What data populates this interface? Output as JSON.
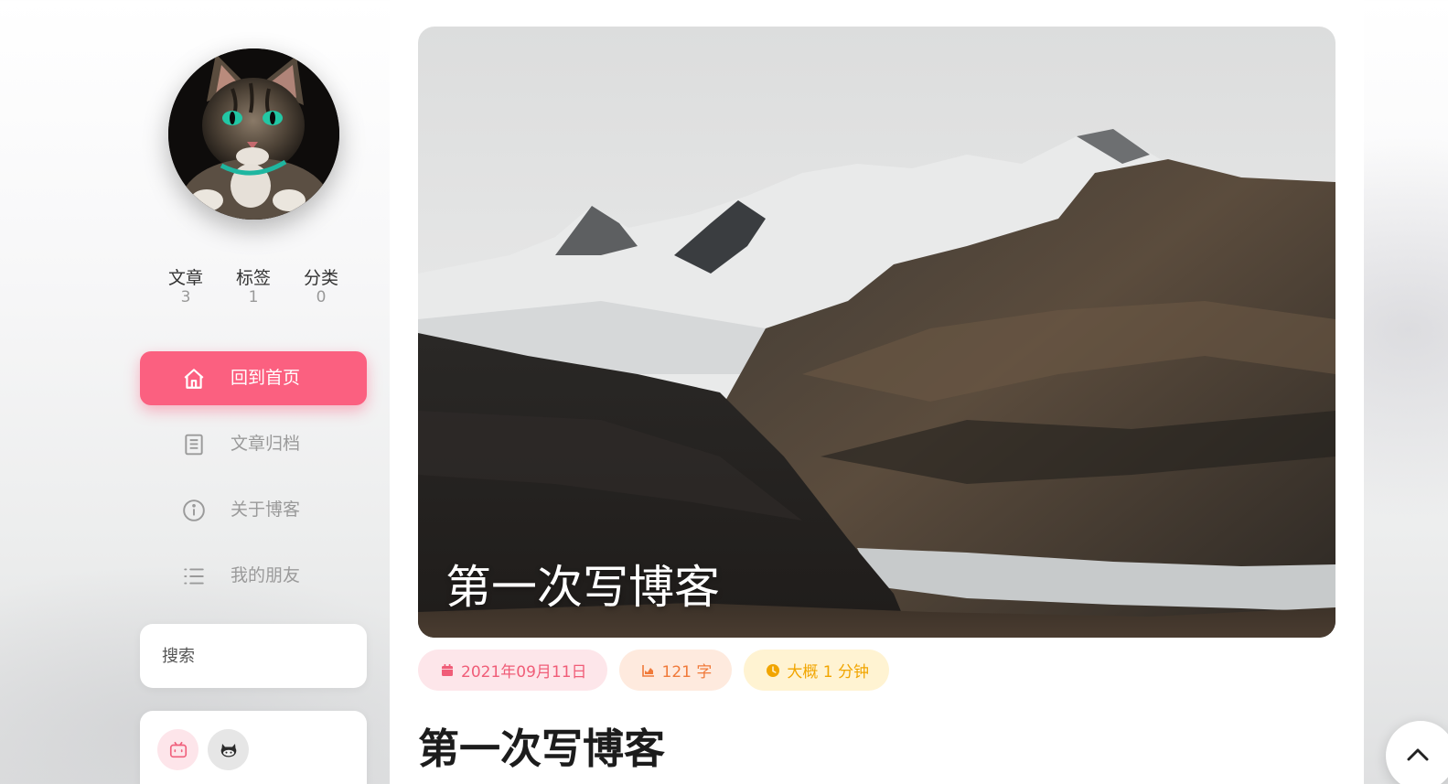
{
  "profile": {
    "stats": [
      {
        "label": "文章",
        "value": "3"
      },
      {
        "label": "标签",
        "value": "1"
      },
      {
        "label": "分类",
        "value": "0"
      }
    ]
  },
  "nav": {
    "items": [
      {
        "label": "回到首页",
        "icon": "home-icon",
        "active": true
      },
      {
        "label": "文章归档",
        "icon": "archive-icon",
        "active": false
      },
      {
        "label": "关于博客",
        "icon": "info-icon",
        "active": false
      },
      {
        "label": "我的朋友",
        "icon": "list-icon",
        "active": false
      }
    ]
  },
  "search": {
    "placeholder": "搜索"
  },
  "social": [
    {
      "icon": "bilibili-icon"
    },
    {
      "icon": "github-icon"
    }
  ],
  "post": {
    "cover_title": "第一次写博客",
    "date": "2021年09月11日",
    "word_count": "121 字",
    "read_time": "大概 1 分钟",
    "title": "第一次写博客"
  },
  "colors": {
    "accent": "#fb6080",
    "date_chip": "#fde6ea",
    "words_chip": "#feeade",
    "time_chip": "#fff3d2"
  }
}
